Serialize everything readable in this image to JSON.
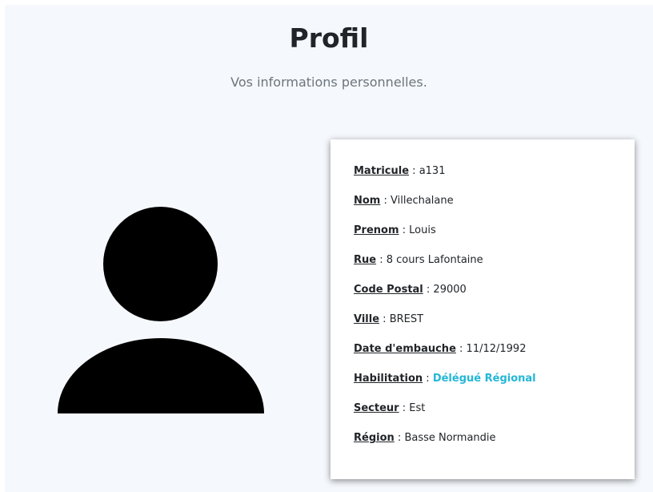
{
  "header": {
    "title": "Profil",
    "subtitle": "Vos informations personnelles."
  },
  "avatar": {
    "icon": "user-silhouette-icon"
  },
  "colors": {
    "background": "#f5f8fc",
    "card": "#ffffff",
    "text": "#212529",
    "muted": "#6c757d",
    "accent": "#22b7d8"
  },
  "profile": {
    "fields": [
      {
        "name": "matricule",
        "label": "Matricule",
        "value": "a131"
      },
      {
        "name": "nom",
        "label": "Nom",
        "value": "Villechalane"
      },
      {
        "name": "prenom",
        "label": "Prenom",
        "value": "Louis"
      },
      {
        "name": "rue",
        "label": "Rue",
        "value": "8 cours Lafontaine"
      },
      {
        "name": "code-postal",
        "label": "Code Postal",
        "value": "29000"
      },
      {
        "name": "ville",
        "label": "Ville",
        "value": "BREST"
      },
      {
        "name": "date-embauche",
        "label": "Date d'embauche",
        "value": "11/12/1992"
      },
      {
        "name": "habilitation",
        "label": "Habilitation",
        "value": "Délégué Régional",
        "highlight": true
      },
      {
        "name": "secteur",
        "label": "Secteur",
        "value": "Est"
      },
      {
        "name": "region",
        "label": "Région",
        "value": "Basse Normandie"
      }
    ]
  }
}
